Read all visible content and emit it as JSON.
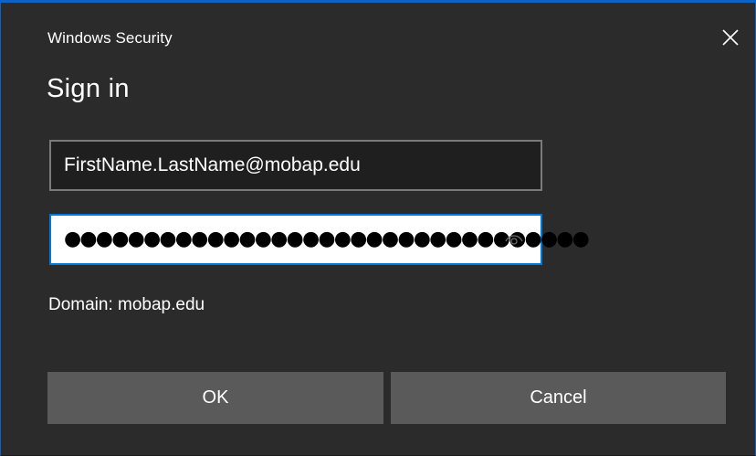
{
  "window": {
    "title": "Windows Security",
    "accent_color": "#0078d7",
    "background_color": "#2b2b2b"
  },
  "header": {
    "title": "Sign in",
    "close_icon": "close-icon"
  },
  "form": {
    "username_value": "FirstName.LastName@mobap.edu",
    "password_masked": "●●●●●●●●●●●●●●●●●●●●●●●●●●●●●●●●●",
    "reveal_icon": "eye-icon",
    "domain_text": "Domain: mobap.edu"
  },
  "actions": {
    "ok_label": "OK",
    "cancel_label": "Cancel",
    "button_color": "#5a5a5a"
  }
}
